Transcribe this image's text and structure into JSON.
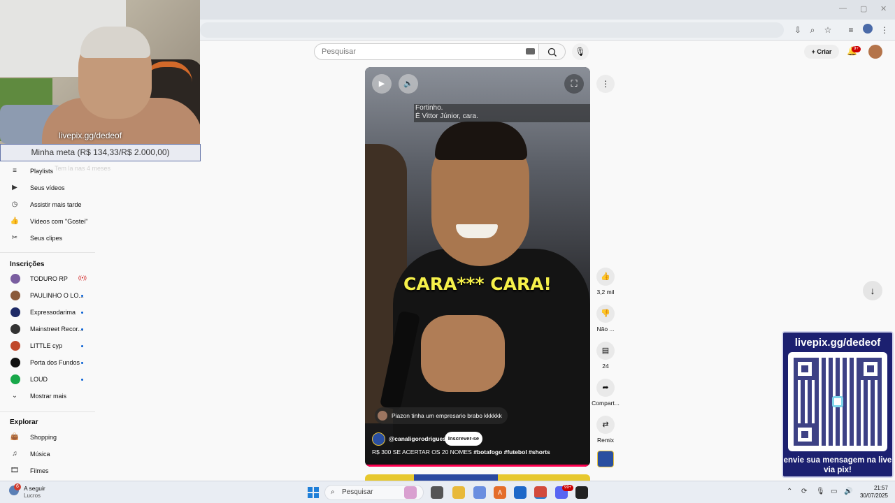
{
  "search": {
    "placeholder": "Pesquisar"
  },
  "header": {
    "create_label": "Criar",
    "notifications_badge": "9+"
  },
  "overlay": {
    "webcam_text": "livepix.gg/dedeof",
    "goal_text": "Minha meta (R$ 134,33/R$ 2.000,00)",
    "ghost_text": "Tem la nas 4 meses"
  },
  "sidebar": {
    "items": [
      {
        "label": "Playlists",
        "icon": "playlist-icon"
      },
      {
        "label": "Seus vídeos",
        "icon": "play-icon"
      },
      {
        "label": "Assistir mais tarde",
        "icon": "clock-icon"
      },
      {
        "label": "Vídeos com \"Gostei\"",
        "icon": "thumbs-up-icon"
      },
      {
        "label": "Seus clipes",
        "icon": "scissors-icon"
      }
    ],
    "subscriptions_title": "Inscrições",
    "subscriptions": [
      {
        "name": "TODURO RP",
        "live": true,
        "color": "#7a5ea0"
      },
      {
        "name": "PAULINHO O LO...",
        "live": false,
        "color": "#8a5a3a"
      },
      {
        "name": "Expressodarima",
        "live": false,
        "color": "#1e2a66"
      },
      {
        "name": "Mainstreet Recor...",
        "live": false,
        "color": "#333333"
      },
      {
        "name": "LITTLE cyp",
        "live": false,
        "color": "#c0482a"
      },
      {
        "name": "Porta dos Fundos",
        "live": false,
        "color": "#111111"
      },
      {
        "name": "LOUD",
        "live": false,
        "color": "#18a84a"
      }
    ],
    "show_more": "Mostrar mais",
    "explore_title": "Explorar",
    "explore": [
      {
        "label": "Shopping",
        "icon": "shopping-bag-icon"
      },
      {
        "label": "Música",
        "icon": "music-note-icon"
      },
      {
        "label": "Filmes",
        "icon": "film-icon"
      }
    ]
  },
  "short": {
    "captions": [
      "Fortinho.",
      "É Vittor Júnior, cara."
    ],
    "overlay_text": "CARA*** CARA!",
    "pinned_comment": "Piazon tinha um empresario brabo kkkkkk",
    "channel": "@canaligorodrigues",
    "subscribe_label": "Inscrever-se",
    "title_plain": "R$ 300 SE ACERTAR OS 20 NOMES ",
    "title_tags": "#botafogo #futebol #shorts"
  },
  "actions": {
    "likes": "3,2 mil",
    "dislike": "Não ...",
    "comments": "24",
    "share": "Compart...",
    "remix": "Remix"
  },
  "qr": {
    "url": "livepix.gg/dedeof",
    "message": "envie sua mensagem na live via pix!"
  },
  "taskbar": {
    "weather_badge": "6",
    "weather_title": "A seguir",
    "weather_sub": "Lucros",
    "search_placeholder": "Pesquisar",
    "time": "21:57",
    "date": "30/07/2025",
    "discord_badge": "99+"
  },
  "colors": {
    "accent": "#ff0050",
    "brand_overlay": "#1c2070",
    "caption_yellow": "#f5f04a"
  }
}
